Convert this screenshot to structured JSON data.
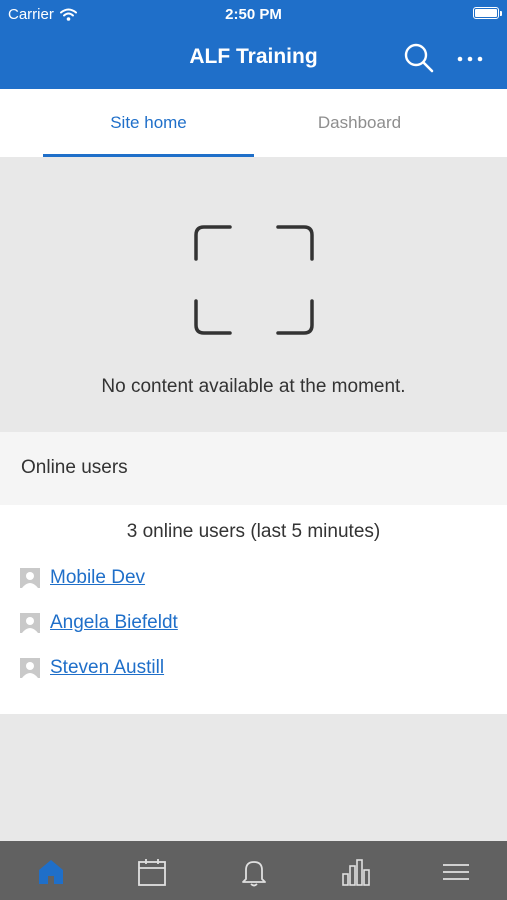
{
  "status_bar": {
    "carrier": "Carrier",
    "time": "2:50 PM"
  },
  "header": {
    "title": "ALF Training",
    "actions": [
      "search-icon",
      "more-icon"
    ]
  },
  "tabs": [
    {
      "label": "Site home",
      "active": true
    },
    {
      "label": "Dashboard",
      "active": false
    }
  ],
  "empty_state": {
    "icon": "scan-frame-icon",
    "message": "No content available at the moment."
  },
  "online_users": {
    "heading": "Online users",
    "summary": "3 online users (last 5 minutes)",
    "users": [
      "Mobile Dev",
      "Angela Biefeldt",
      "Steven Austill"
    ]
  },
  "bottom_nav": {
    "items": [
      "home-icon",
      "calendar-icon",
      "bell-icon",
      "chart-icon",
      "menu-icon"
    ],
    "active": "home-icon"
  },
  "colors": {
    "accent": "#1f6fc9",
    "header_bg": "#1f6fc9",
    "tabbar_bg": "#616161",
    "page_bg": "#e8e8e8"
  }
}
